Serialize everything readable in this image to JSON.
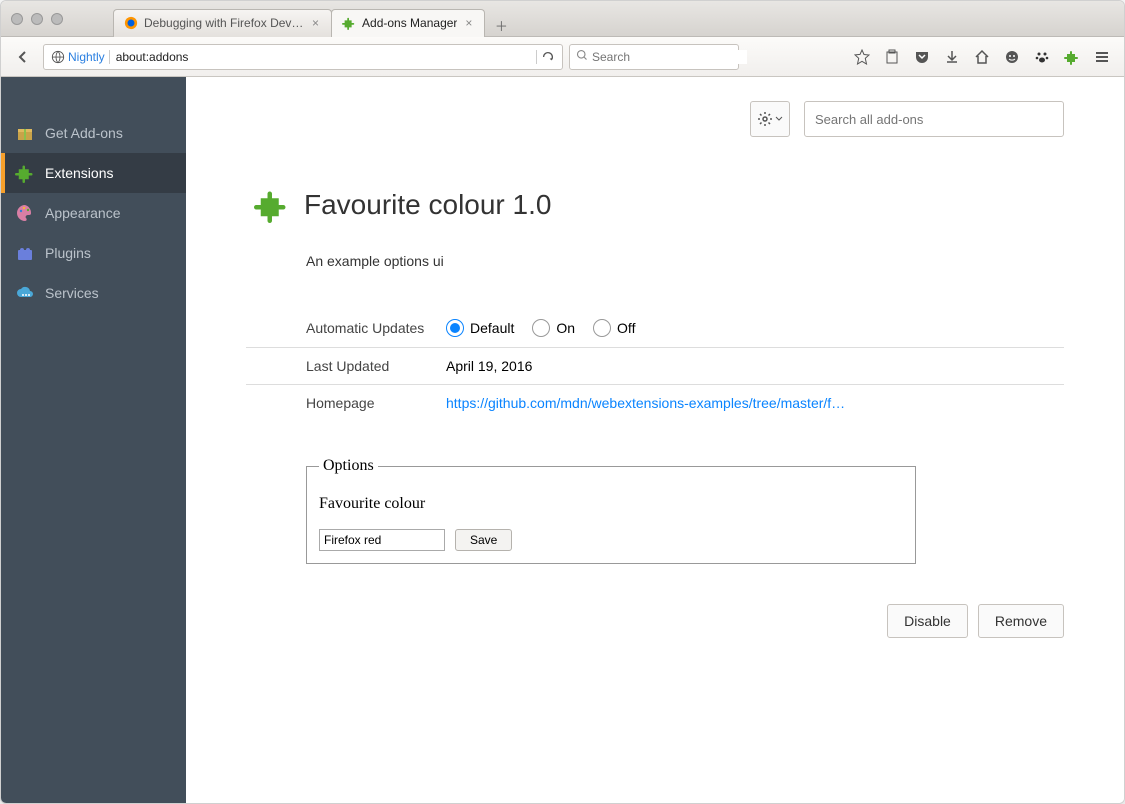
{
  "tabs": [
    {
      "label": "Debugging with Firefox Develop…",
      "favicon": "firefox"
    },
    {
      "label": "Add-ons Manager",
      "favicon": "puzzle"
    }
  ],
  "toolbar": {
    "brand": "Nightly",
    "url": "about:addons",
    "search_placeholder": "Search"
  },
  "sidebar": {
    "items": [
      {
        "label": "Get Add-ons",
        "icon": "gift"
      },
      {
        "label": "Extensions",
        "icon": "puzzle",
        "active": true
      },
      {
        "label": "Appearance",
        "icon": "palette"
      },
      {
        "label": "Plugins",
        "icon": "lego"
      },
      {
        "label": "Services",
        "icon": "cloud"
      }
    ]
  },
  "addons_search_placeholder": "Search all add-ons",
  "addon": {
    "title": "Favourite colour 1.0",
    "description": "An example options ui",
    "updates_label": "Automatic Updates",
    "updates_options": {
      "default": "Default",
      "on": "On",
      "off": "Off"
    },
    "updates_selected": "default",
    "last_updated_label": "Last Updated",
    "last_updated_value": "April 19, 2016",
    "homepage_label": "Homepage",
    "homepage_value": "https://github.com/mdn/webextensions-examples/tree/master/f…",
    "options_legend": "Options",
    "option_field_label": "Favourite colour",
    "option_field_value": "Firefox red",
    "save_label": "Save",
    "disable_label": "Disable",
    "remove_label": "Remove"
  }
}
